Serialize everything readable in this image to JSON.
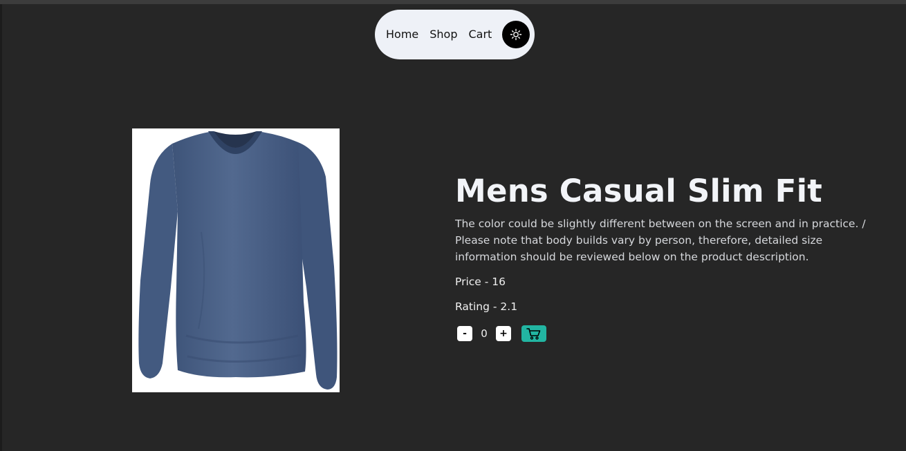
{
  "nav": {
    "links": [
      "Home",
      "Shop",
      "Cart"
    ],
    "theme_toggle_icon": "sun-icon"
  },
  "product": {
    "image_icon": "tshirt-image",
    "image_color": "#4a6189",
    "title": "Mens Casual Slim Fit",
    "description": "The color could be slightly different between on the screen and in practice. / Please note that body builds vary by person, therefore, detailed size information should be reviewed below on the product description.",
    "price_text": "Price - 16",
    "rating_text": "Rating - 2.1"
  },
  "cart_controls": {
    "minus_label": "-",
    "quantity": "0",
    "plus_label": "+",
    "add_icon": "cart-icon",
    "accent_color": "#22b5a2"
  },
  "colors": {
    "background": "#262626",
    "navbar": "#eef1f7"
  }
}
